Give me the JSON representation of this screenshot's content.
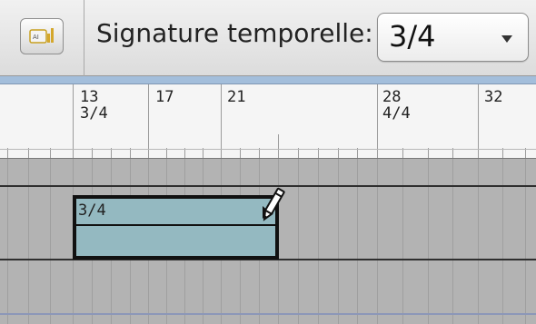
{
  "toolbar": {
    "tool_icon": "signature-tool-icon",
    "signature_label": "Signature temporelle:",
    "signature_value": "3/4"
  },
  "ruler": {
    "bars": [
      {
        "number": "13",
        "signature": "3/4"
      },
      {
        "number": "17",
        "signature": ""
      },
      {
        "number": "21",
        "signature": ""
      },
      {
        "number": "28",
        "signature": "4/4"
      },
      {
        "number": "32",
        "signature": ""
      }
    ]
  },
  "track": {
    "region_label": "3/4",
    "cursor_icon": "pencil-icon"
  },
  "colors": {
    "region_fill": "#94b9c1",
    "ruler_background": "#f5f5f5",
    "track_background": "#b3b3b3",
    "band": "#a3bedb"
  }
}
